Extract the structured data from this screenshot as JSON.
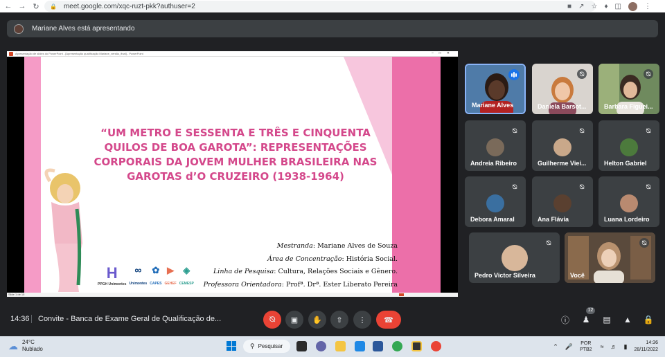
{
  "browser": {
    "url": "meet.google.com/xqc-ruzt-pkk?authuser=2"
  },
  "banner": {
    "text": "Mariane Alves está apresentando"
  },
  "presentation": {
    "window_title": "Apresentação de slides do PowerPoint - [Apresentação qualificação Mariane_versão_final] - PowerPoint",
    "slide_title": "“UM METRO E SESSENTA E TRÊS E CINQUENTA QUILOS DE BOA GAROTA”: REPRESENTAÇÕES CORPORAIS DA JOVEM MULHER BRASILEIRA NAS GAROTAS d’O CRUZEIRO (1938-1964)",
    "info": [
      {
        "label": "Mestranda",
        "value": ": Mariane Alves de Souza"
      },
      {
        "label": "Área de Concentração",
        "value": ": História Social."
      },
      {
        "label": "Linha de Pesquisa",
        "value": ": Cultura, Relações Sociais e Gênero."
      },
      {
        "label": "Professora Orientadora",
        "value": ": Profª. Drª. Ester Liberato Pereira"
      }
    ],
    "logos": [
      "PPGH Unimontes",
      "Unimontes",
      "CAPES",
      "GEHEF",
      "CEMESP"
    ],
    "status_text": "Slide 1 de 15"
  },
  "participants": [
    {
      "name": "Mariane Alves",
      "speaking": true
    },
    {
      "name": "Daniela Barsot...",
      "muted": true
    },
    {
      "name": "Barbara Figuei...",
      "muted": true
    },
    {
      "name": "Andreia Ribeiro",
      "muted": true
    },
    {
      "name": "Guilherme Viei...",
      "muted": true
    },
    {
      "name": "Helton Gabriel",
      "muted": true
    },
    {
      "name": "Debora Amaral",
      "muted": true
    },
    {
      "name": "Ana Flávia",
      "muted": true
    },
    {
      "name": "Luana Lordeiro",
      "muted": true
    },
    {
      "name": "Pedro Victor Silveira",
      "muted": true
    },
    {
      "name": "Você",
      "muted": true
    }
  ],
  "controls": {
    "time": "14:36",
    "meeting_title": "Convite - Banca de Exame Geral de Qualificação de...",
    "people_count": "12"
  },
  "taskbar": {
    "temperature": "24°C",
    "weather": "Nublado",
    "search_label": "Pesquisar",
    "lang_line1": "POR",
    "lang_line2": "PTB2",
    "clock_time": "14:36",
    "clock_date": "28/11/2022"
  },
  "colors": {
    "accent_blue": "#8ab4f8",
    "hangup_red": "#ea4335",
    "slide_pink": "#d4488b"
  }
}
